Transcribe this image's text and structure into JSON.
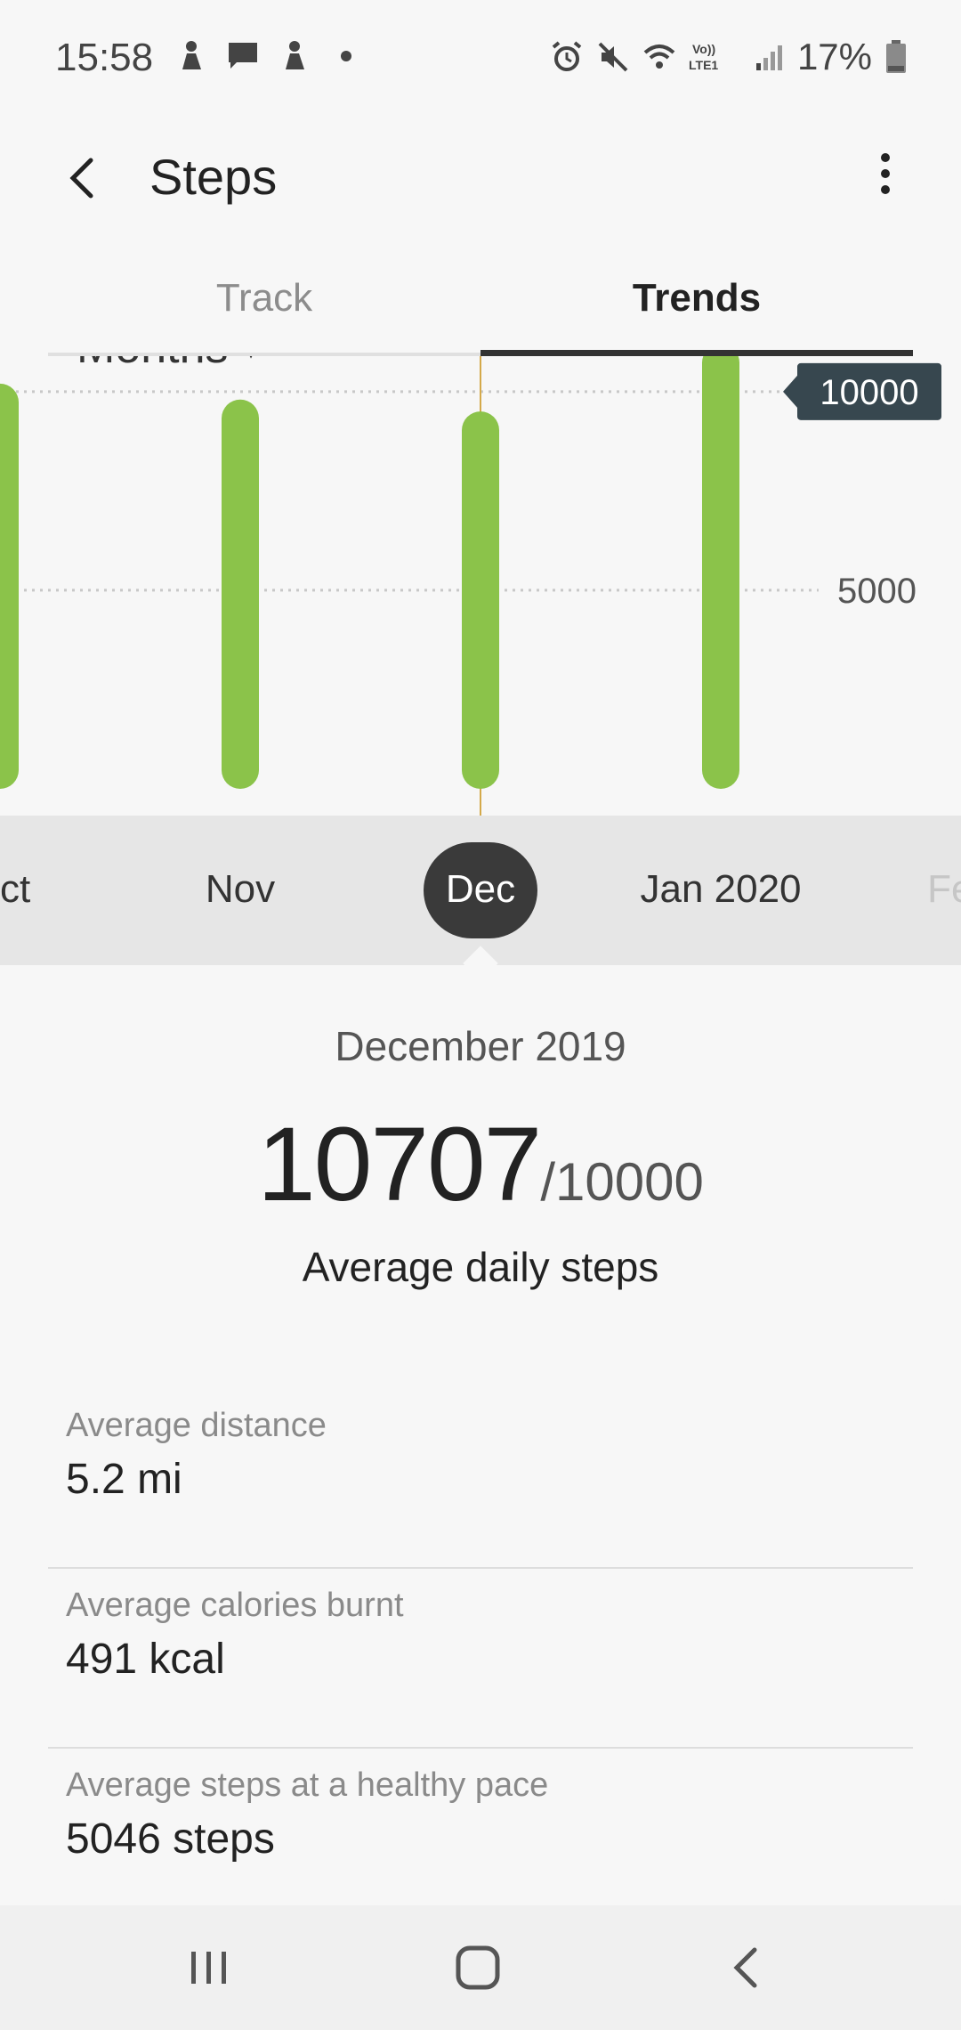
{
  "status_bar": {
    "time": "15:58",
    "battery_percent": "17%",
    "left_icons": [
      "person-notification-icon",
      "message-icon",
      "person-notification-icon",
      "dot-icon"
    ],
    "right_icons": [
      "alarm-icon",
      "mute-icon",
      "wifi-icon",
      "volte-icon",
      "signal-icon",
      "battery-icon"
    ],
    "volte_text": "Vo)) LTE1"
  },
  "app_bar": {
    "title": "Steps",
    "back_icon": "back-arrow-icon",
    "menu_icon": "more-vertical-icon"
  },
  "tabs": [
    {
      "label": "Track",
      "selected": false
    },
    {
      "label": "Trends",
      "selected": true
    }
  ],
  "period_selector": {
    "label": "Months"
  },
  "chart_data": {
    "type": "bar",
    "categories": [
      "Oct",
      "Nov",
      "Dec",
      "Jan 2020"
    ],
    "values": [
      10200,
      9800,
      9500,
      11200
    ],
    "y_tick_labels": [
      "5000",
      "10000"
    ],
    "goal_marker": "10000",
    "selected_category": "Dec",
    "ylim": [
      0,
      13000
    ],
    "grid": "dotted horizontal",
    "colors": {
      "bar": "#8bc34a",
      "goal_badge": "#37474f",
      "selection_line": "#d4a94a"
    }
  },
  "month_strip": {
    "labels": [
      "Oct",
      "Nov",
      "Dec",
      "Jan 2020",
      "Feb"
    ],
    "selected": "Dec"
  },
  "detail": {
    "period": "December 2019",
    "value": "10707",
    "goal": "/10000",
    "caption": "Average daily steps",
    "stats": [
      {
        "label": "Average distance",
        "value": "5.2 mi"
      },
      {
        "label": "Average calories burnt",
        "value": "491 kcal"
      },
      {
        "label": "Average steps at a healthy pace",
        "value": "5046 steps"
      }
    ]
  },
  "nav_bar": {
    "buttons": [
      "recents-icon",
      "home-icon",
      "back-icon"
    ]
  }
}
